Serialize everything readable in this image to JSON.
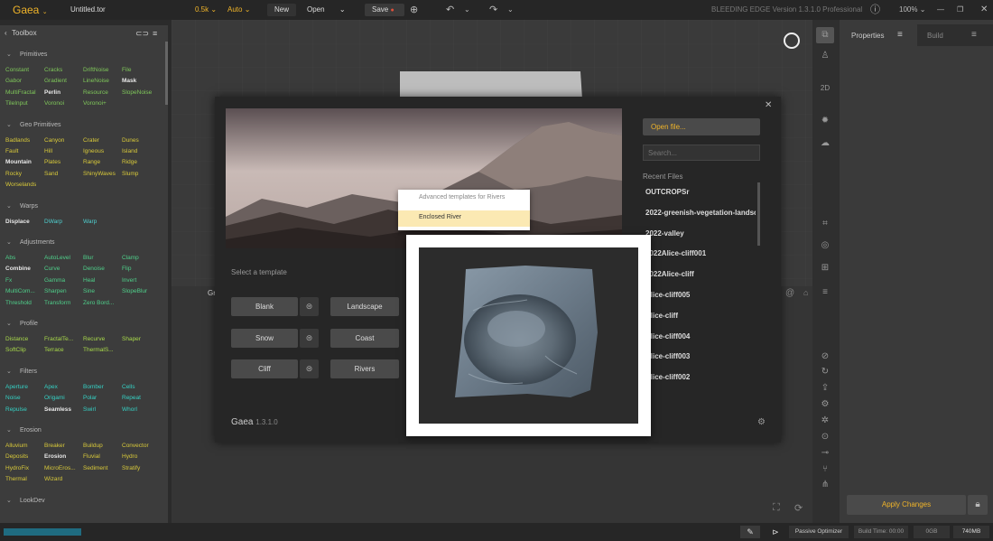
{
  "topbar": {
    "app_name": "Gaea",
    "file_name": "Untitled.tor",
    "resolution": "0.5k",
    "mode": "Auto",
    "new_label": "New",
    "open_label": "Open",
    "save_label": "Save",
    "edition": "BLEEDING EDGE Version 1.3.1.0 Professional",
    "zoom": "100%"
  },
  "toolbox": {
    "title": "Toolbox",
    "categories": [
      {
        "name": "Primitives",
        "items": [
          "Constant",
          "Cracks",
          "DriftNoise",
          "File",
          "Gabor",
          "Gradient",
          "LineNoise",
          "Mask",
          "MultiFractal",
          "Perlin",
          "Resource",
          "SlopeNoise",
          "TileInput",
          "Voronoi",
          "Voronoi+"
        ]
      },
      {
        "name": "Geo Primitives",
        "items": [
          "Badlands",
          "Canyon",
          "Crater",
          "Dunes",
          "Fault",
          "Hill",
          "Igneous",
          "Island",
          "Mountain",
          "Plates",
          "Range",
          "Ridge",
          "Rocky",
          "Sand",
          "ShinyWaves",
          "Slump",
          "Worselands"
        ]
      },
      {
        "name": "Warps",
        "items": [
          "Displace",
          "DWarp",
          "Warp"
        ]
      },
      {
        "name": "Adjustments",
        "items": [
          "Abs",
          "AutoLevel",
          "Blur",
          "Clamp",
          "Combine",
          "Curve",
          "Denoise",
          "Flip",
          "Fx",
          "Gamma",
          "Heal",
          "Invert",
          "MultiCom...",
          "Sharpen",
          "Sine",
          "SlopeBlur",
          "Threshold",
          "Transform",
          "Zero Bord..."
        ]
      },
      {
        "name": "Profile",
        "items": [
          "Distance",
          "FractalTe...",
          "Recurve",
          "Shaper",
          "SoftClip",
          "Terrace",
          "ThermalS..."
        ]
      },
      {
        "name": "Filters",
        "items": [
          "Aperture",
          "Apex",
          "Bomber",
          "Cells",
          "Noise",
          "Origami",
          "Polar",
          "Repeat",
          "Repulse",
          "Seamless",
          "Swirl",
          "Whorl"
        ]
      },
      {
        "name": "Erosion",
        "items": [
          "Alluvium",
          "Breaker",
          "Buildup",
          "Convector",
          "Deposits",
          "Erosion",
          "Fluvial",
          "Hydro",
          "HydroFix",
          "MicroEros...",
          "Sediment",
          "Stratify",
          "Thermal",
          "Wizard"
        ]
      },
      {
        "name": "LookDev",
        "items": []
      }
    ]
  },
  "right_strip": {
    "label_2d": "2D"
  },
  "properties": {
    "tab_properties": "Properties",
    "tab_build": "Build",
    "apply_label": "Apply Changes"
  },
  "dialog": {
    "select_template": "Select a template",
    "templates": [
      "Blank",
      "Landscape",
      "Snow",
      "Coast",
      "Cliff",
      "Rivers"
    ],
    "product": "Gaea",
    "version": "1.3.1.0",
    "open_file": "Open file...",
    "search_placeholder": "Search...",
    "recent_title": "Recent Files",
    "recent_files": [
      "OUTCROPSr",
      "2022-greenish-vegetation-landsc...",
      "2022-valley",
      "2022Alice-cliff001",
      "2022Alice-cliff",
      "Alice-cliff005",
      "Alice-cliff",
      "Alice-cliff004",
      "Alice-cliff003",
      "Alice-cliff002"
    ],
    "dropdown_header": "Advanced templates for Rivers",
    "dropdown_selected": "Enclosed River"
  },
  "viewport": {
    "graph_label": "Gr"
  },
  "status": {
    "optimizer": "Passive Optimizer",
    "build_time": "Build Time: 00:00",
    "gb": "0GB",
    "mem": "740MB"
  },
  "colors": {
    "accent": "#f0b429",
    "primitive_green": "#7fc75a",
    "warp_teal": "#4fd0d0",
    "adjust_green": "#4fcf8a",
    "profile_lime": "#a8d94a",
    "filter_cyan": "#35d1c4",
    "erosion_yellow": "#d8c93a",
    "dropdown_highlight": "#fbe9b3"
  }
}
